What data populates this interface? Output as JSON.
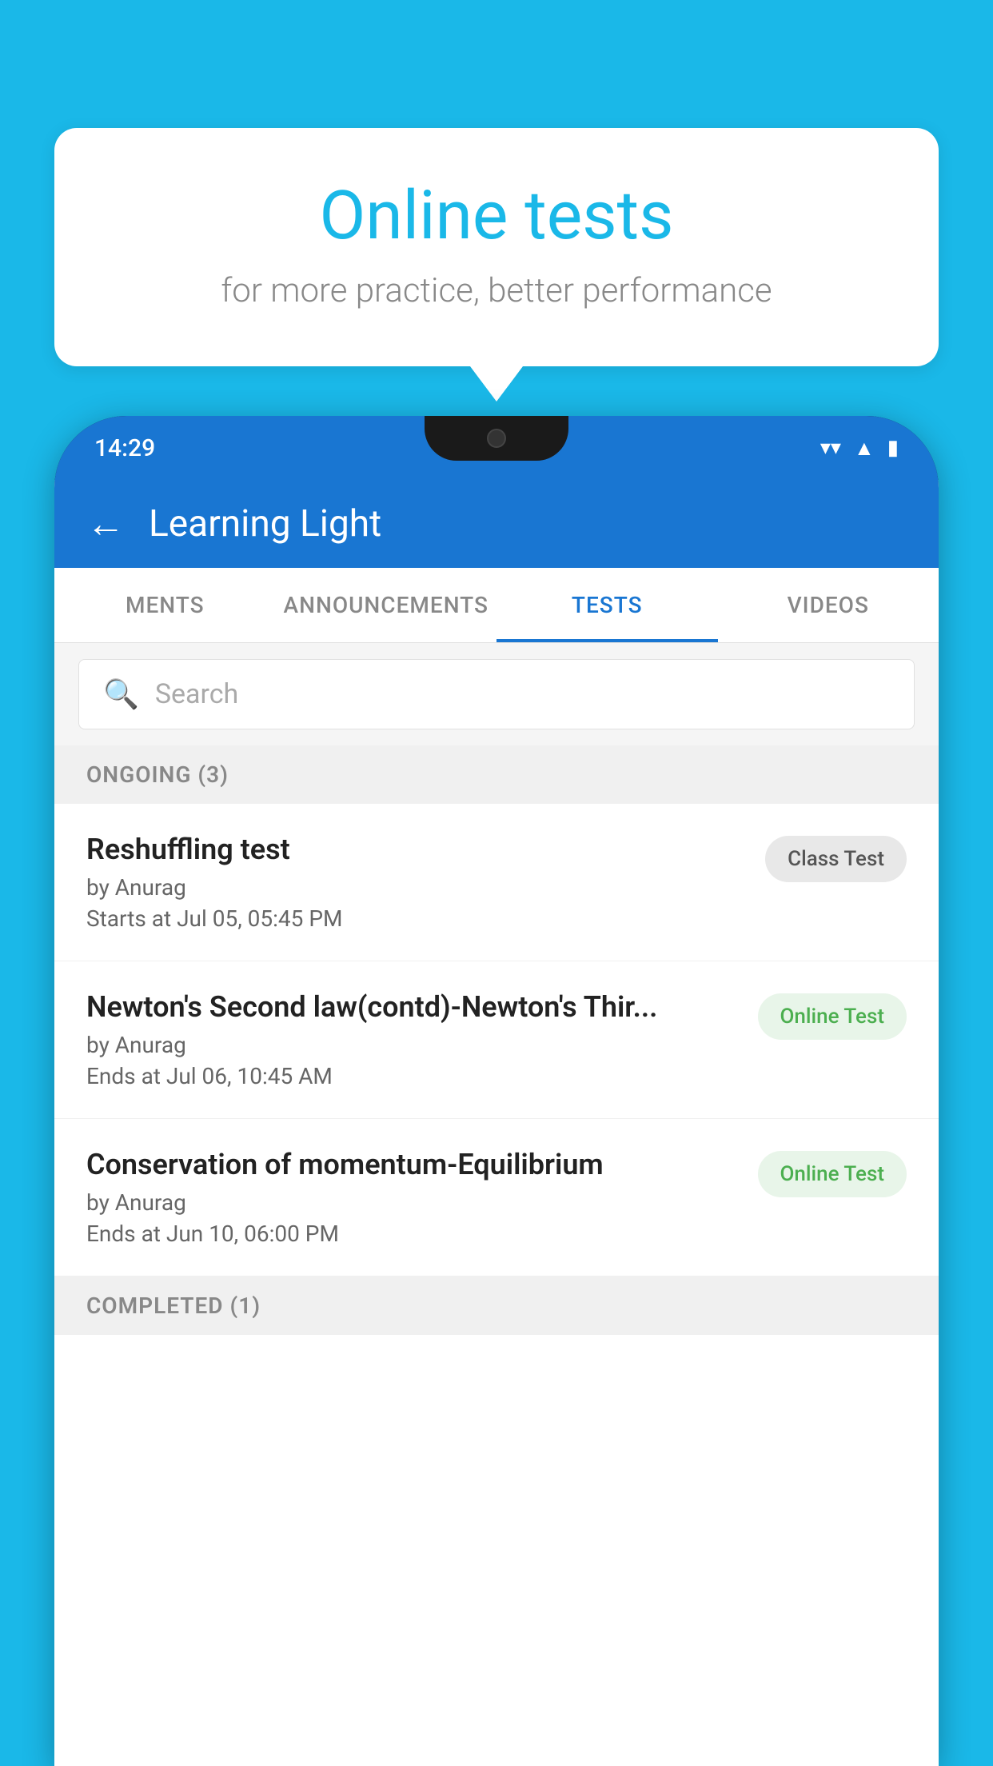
{
  "background_color": "#1ab8e8",
  "speech_bubble": {
    "title": "Online tests",
    "subtitle": "for more practice, better performance"
  },
  "phone": {
    "status_bar": {
      "time": "14:29",
      "wifi": "▼",
      "signal": "▲",
      "battery": "▮"
    },
    "app_header": {
      "back_label": "←",
      "title": "Learning Light"
    },
    "tabs": [
      {
        "label": "MENTS",
        "active": false
      },
      {
        "label": "ANNOUNCEMENTS",
        "active": false
      },
      {
        "label": "TESTS",
        "active": true
      },
      {
        "label": "VIDEOS",
        "active": false
      }
    ],
    "search": {
      "placeholder": "Search"
    },
    "section_ongoing": {
      "label": "ONGOING (3)"
    },
    "tests": [
      {
        "name": "Reshuffling test",
        "by": "by Anurag",
        "date": "Starts at  Jul 05, 05:45 PM",
        "badge": "Class Test",
        "badge_type": "class"
      },
      {
        "name": "Newton's Second law(contd)-Newton's Thir...",
        "by": "by Anurag",
        "date": "Ends at  Jul 06, 10:45 AM",
        "badge": "Online Test",
        "badge_type": "online"
      },
      {
        "name": "Conservation of momentum-Equilibrium",
        "by": "by Anurag",
        "date": "Ends at  Jun 10, 06:00 PM",
        "badge": "Online Test",
        "badge_type": "online"
      }
    ],
    "section_completed": {
      "label": "COMPLETED (1)"
    }
  }
}
